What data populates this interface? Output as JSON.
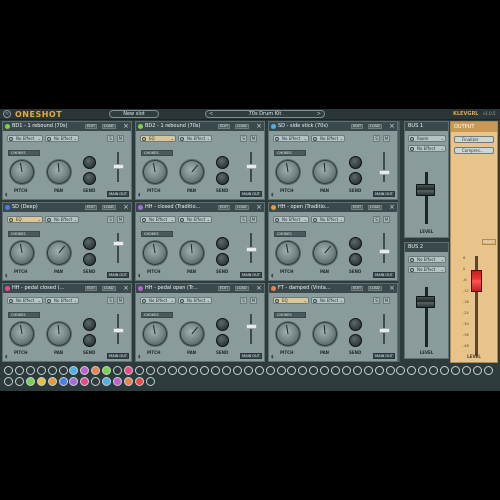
{
  "app": {
    "logo": "ONESHOT",
    "new_slot": "New slot",
    "kit": "70s Drum Kit",
    "kit_prev": "<",
    "kit_next": ">",
    "brand": "KLEVGRL",
    "version": "v1.0.5"
  },
  "slot_common": {
    "edit": "EDIT",
    "load": "LOAD",
    "close": "×",
    "solo": "S",
    "mute": "M",
    "chokes": "CHOKES",
    "pitch": "PITCH",
    "pan": "PAN",
    "send": "SEND",
    "main_out": "MAIN OUT",
    "no_effect": "No Effect",
    "eq": "EQ"
  },
  "slots": [
    {
      "name": "BD1 - 1 rebound (70s)",
      "color": "#7bd24a",
      "fx1": "No Effect",
      "fx2": "No Effect"
    },
    {
      "name": "BD2 - 1 rebound (70s)",
      "color": "#7bd24a",
      "fx1": "EQ",
      "fx2": "No Effect"
    },
    {
      "name": "SD - side stick (70s)",
      "color": "#4ab0e6",
      "fx1": "No Effect",
      "fx2": "No Effect"
    },
    {
      "name": "SD (Deep)",
      "color": "#4a7ce6",
      "fx1": "EQ",
      "fx2": "No Effect"
    },
    {
      "name": "HH - closed (Traditio...",
      "color": "#a46ae0",
      "fx1": "No Effect",
      "fx2": "No Effect"
    },
    {
      "name": "HH - open (Traditio...",
      "color": "#e69a3a",
      "fx1": "No Effect",
      "fx2": "No Effect"
    },
    {
      "name": "HH - pedal closed (...",
      "color": "#e64a8a",
      "fx1": "No Effect",
      "fx2": "No Effect"
    },
    {
      "name": "HH - pedal open (Tr...",
      "color": "#c060d0",
      "fx1": "No Effect",
      "fx2": "No Effect"
    },
    {
      "name": "FT - damped (Vinta...",
      "color": "#e6844a",
      "fx1": "EQ",
      "fx2": "No Effect"
    }
  ],
  "buses": [
    {
      "title": "BUS 1",
      "fx1": "Room",
      "fx2": "No Effect",
      "level_label": "LEVEL"
    },
    {
      "title": "BUS 2",
      "fx1": "No Effect",
      "fx2": "No Effect",
      "level_label": "LEVEL"
    }
  ],
  "output": {
    "title": "OUTPUT",
    "fx1": "Finalizer",
    "fx2": "Compres...",
    "reset": "RESET",
    "level_label": "LEVEL",
    "scale": [
      "6",
      "0",
      "-6",
      "-12",
      "-18",
      "-24",
      "-30",
      "-36",
      "-48"
    ]
  },
  "pads": {
    "row1_colors": [
      "#2d3b3d",
      "#2d3b3d",
      "#2d3b3d",
      "#2d3b3d",
      "#2d3b3d",
      "#2d3b3d",
      "#4ab0e6",
      "#c060d0",
      "#e6844a",
      "#7bd24a",
      "#2d3b3d",
      "#e64a8a",
      "#2d3b3d",
      "#2d3b3d",
      "#2d3b3d",
      "#2d3b3d",
      "#2d3b3d",
      "#2d3b3d",
      "#2d3b3d",
      "#2d3b3d",
      "#2d3b3d",
      "#2d3b3d",
      "#2d3b3d",
      "#2d3b3d",
      "#2d3b3d",
      "#2d3b3d",
      "#2d3b3d",
      "#2d3b3d",
      "#2d3b3d",
      "#2d3b3d",
      "#2d3b3d",
      "#2d3b3d",
      "#2d3b3d",
      "#2d3b3d",
      "#2d3b3d",
      "#2d3b3d",
      "#2d3b3d",
      "#2d3b3d",
      "#2d3b3d",
      "#2d3b3d",
      "#2d3b3d",
      "#2d3b3d",
      "#2d3b3d",
      "#2d3b3d",
      "#2d3b3d"
    ],
    "row2_colors": [
      "#2d3b3d",
      "#2d3b3d",
      "#7bd24a",
      "#e6c43a",
      "#e69a3a",
      "#4a7ce6",
      "#a46ae0",
      "#e64a8a",
      "#2d3b3d",
      "#4ab0e6",
      "#c060d0",
      "#e6844a",
      "#e64a4a",
      "#2d3b3d"
    ]
  }
}
